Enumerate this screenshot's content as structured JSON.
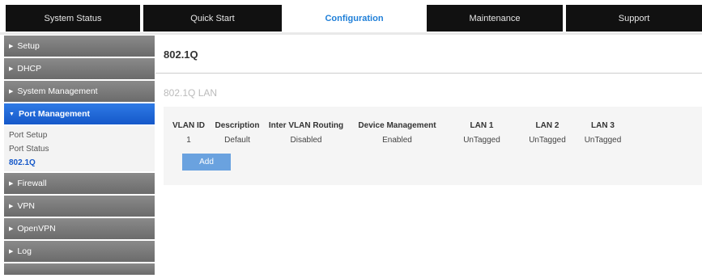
{
  "topnav": {
    "tabs": [
      {
        "label": "System Status"
      },
      {
        "label": "Quick Start"
      },
      {
        "label": "Configuration"
      },
      {
        "label": "Maintenance"
      },
      {
        "label": "Support"
      }
    ],
    "active": "Configuration"
  },
  "sidebar": {
    "items": [
      {
        "label": "Setup"
      },
      {
        "label": "DHCP"
      },
      {
        "label": "System Management"
      },
      {
        "label": "Port Management"
      },
      {
        "label": "Firewall"
      },
      {
        "label": "VPN"
      },
      {
        "label": "OpenVPN"
      },
      {
        "label": "Log"
      }
    ],
    "submenu": [
      {
        "label": "Port Setup"
      },
      {
        "label": "Port Status"
      },
      {
        "label": "802.1Q"
      }
    ]
  },
  "main": {
    "title": "802.1Q",
    "section_title": "802.1Q LAN",
    "table": {
      "headers": [
        "VLAN ID",
        "Description",
        "Inter VLAN Routing",
        "Device Management",
        "LAN 1",
        "LAN 2",
        "LAN 3"
      ],
      "rows": [
        [
          "1",
          "Default",
          "Disabled",
          "Enabled",
          "UnTagged",
          "UnTagged",
          "UnTagged"
        ]
      ]
    },
    "add_label": "Add"
  }
}
